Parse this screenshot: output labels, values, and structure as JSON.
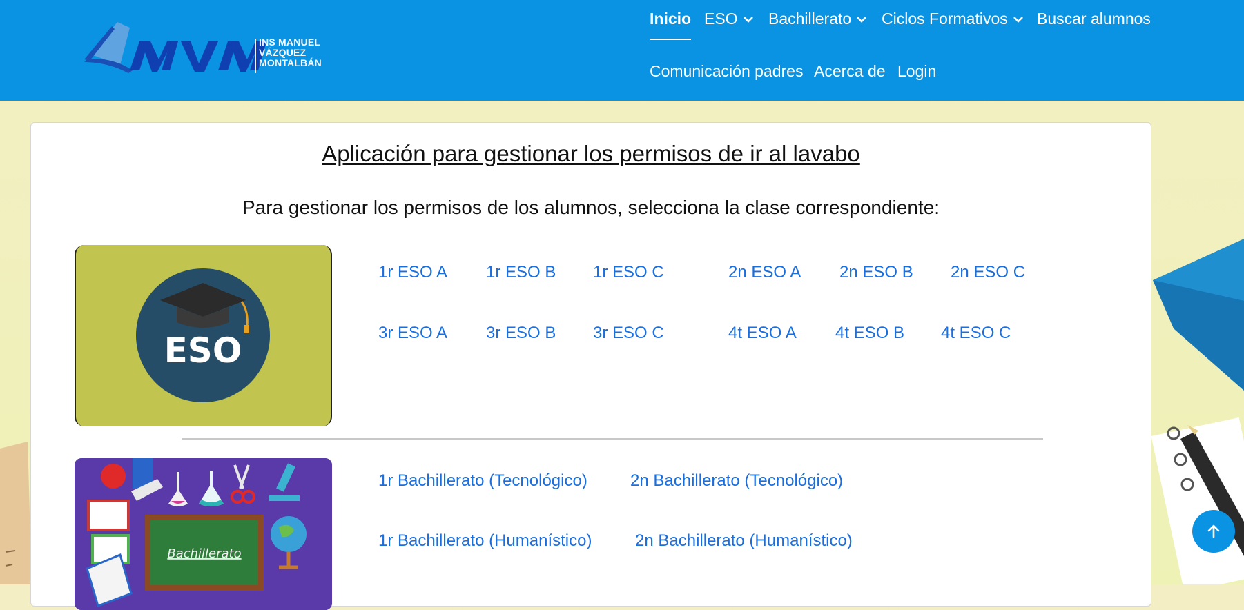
{
  "brand": {
    "logo_letters": "MVM",
    "lines": [
      "INS MANUEL",
      "VÁZQUEZ",
      "MONTALBÁN"
    ]
  },
  "nav": {
    "inicio": "Inicio",
    "eso": "ESO",
    "bachillerato": "Bachillerato",
    "ciclos": "Ciclos Formativos",
    "buscar": "Buscar alumnos",
    "comunicacion": "Comunicación padres",
    "acerca": "Acerca de",
    "login": "Login"
  },
  "main": {
    "title": "Aplicación para gestionar los permisos de ir al lavabo",
    "subtitle": "Para gestionar los permisos de los alumnos, selecciona la clase correspondiente:",
    "eso_image_label": "ESO",
    "bach_image_label": "Bachillerato",
    "eso_classes": [
      "1r ESO A",
      "1r ESO B",
      "1r ESO C",
      "2n ESO A",
      "2n ESO B",
      "2n ESO C",
      "3r ESO A",
      "3r ESO B",
      "3r ESO C",
      "4t ESO A",
      "4t ESO B",
      "4t ESO C"
    ],
    "bach_classes": [
      "1r Bachillerato (Tecnológico)",
      "2n Bachillerato (Tecnológico)",
      "1r Bachillerato (Humanístico)",
      "2n Bachillerato (Humanístico)"
    ]
  },
  "icons": {
    "chevron": "chevron-down-icon",
    "scroll_top": "arrow-up-icon"
  },
  "colors": {
    "header": "#0b93e3",
    "link": "#1a6fe0",
    "eso_bg": "#c1c54f",
    "eso_circle": "#254d67"
  }
}
